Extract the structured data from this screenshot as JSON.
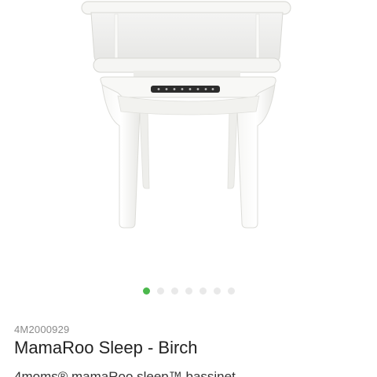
{
  "product": {
    "sku": "4M2000929",
    "title": "MamaRoo Sleep - Birch",
    "description_preview": "4moms® mamaRoo sleep™ bassinet... "
  },
  "carousel": {
    "count": 7,
    "active_index": 0,
    "active_color": "#4bb84c",
    "inactive_color": "#e9e9e9"
  },
  "image": {
    "subject": "bassinet-product-photo"
  }
}
